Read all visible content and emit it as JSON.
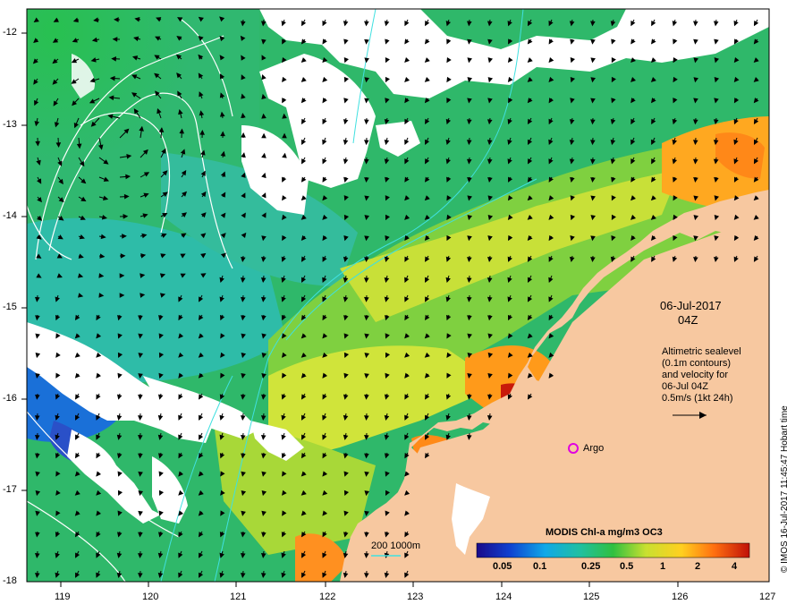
{
  "map": {
    "lon_ticks": [
      "119",
      "120",
      "121",
      "122",
      "123",
      "124",
      "125",
      "126",
      "127"
    ],
    "lat_ticks": [
      "-12",
      "-13",
      "-14",
      "-15",
      "-16",
      "-17",
      "-18"
    ],
    "date_line1": "06-Jul-2017",
    "date_line2": "04Z",
    "legend_lines": [
      "Altimetric sealevel",
      "(0.1m contours)",
      "and velocity for",
      "06-Jul 04Z",
      "0.5m/s (1kt 24h)"
    ],
    "argo_label": "Argo",
    "bathy_label": "200  1000m",
    "credit": "© IMOS 16-Jul-2017 11:45:47 Hobart time",
    "colorbar_title": "MODIS Chl-a mg/m3 OC3",
    "colorbar_ticks": [
      "0.05",
      "0.1",
      "0.25",
      "0.5",
      "1",
      "2",
      "4"
    ],
    "colors": {
      "land": "#f7c8a0",
      "cloud": "#ffffff",
      "ocean_green": "#2fb85a",
      "ocean_cyan": "#34c0c8",
      "ocean_blue": "#1a6ad8",
      "yellow": "#d8e83a",
      "orange": "#ff9a1a",
      "red": "#c81a0a",
      "argo": "#e000e0",
      "contour": "#ffffff",
      "bathy": "#40e0e0"
    }
  }
}
